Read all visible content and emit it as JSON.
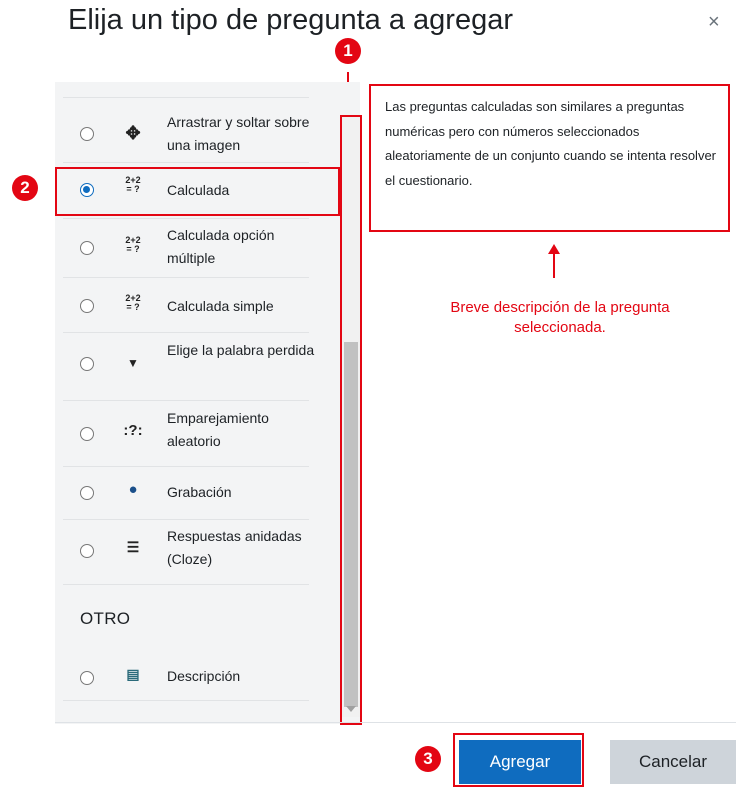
{
  "dialog": {
    "title": "Elija un tipo de pregunta a agregar",
    "close_symbol": "×"
  },
  "question_types": [
    {
      "label": "Arrastrar y soltar sobre una imagen",
      "icon": "move-arrows-icon",
      "glyph": "✥",
      "selected": false
    },
    {
      "label": "Calculada",
      "icon": "calculated-icon",
      "glyph": "2+2\n=?",
      "selected": true
    },
    {
      "label": "Calculada opción múltiple",
      "icon": "calculated-multichoice-icon",
      "glyph": "2+2\n=?",
      "selected": false
    },
    {
      "label": "Calculada simple",
      "icon": "calculated-simple-icon",
      "glyph": "2+2\n=?",
      "selected": false
    },
    {
      "label": "Elige la palabra perdida",
      "icon": "dropdown-caret-icon",
      "glyph": "▼",
      "selected": false
    },
    {
      "label": "Emparejamiento aleatorio",
      "icon": "random-match-icon",
      "glyph": ":?:",
      "selected": false
    },
    {
      "label": "Grabación",
      "icon": "headset-icon",
      "glyph": "🎧",
      "selected": false
    },
    {
      "label": "Respuestas anidadas (Cloze)",
      "icon": "cloze-icon",
      "glyph": "☰",
      "selected": false
    }
  ],
  "other_section": {
    "title": "OTRO",
    "items": [
      {
        "label": "Descripción",
        "icon": "description-icon",
        "glyph": "▤",
        "selected": false
      }
    ]
  },
  "description": "Las preguntas calculadas son similares a preguntas numéricas pero con números seleccionados aleatoriamente de un conjunto cuando se intenta resolver el cuestionario.",
  "annotations": {
    "badge_1": "1",
    "badge_2": "2",
    "badge_3": "3",
    "note": "Breve descripción de la pregunta seleccionada."
  },
  "buttons": {
    "add": "Agregar",
    "cancel": "Cancelar"
  },
  "colors": {
    "primary": "#0f6cbf",
    "annotation_red": "#e30613",
    "secondary_button": "#ced4da",
    "panel_bg": "#f3f4f5"
  }
}
